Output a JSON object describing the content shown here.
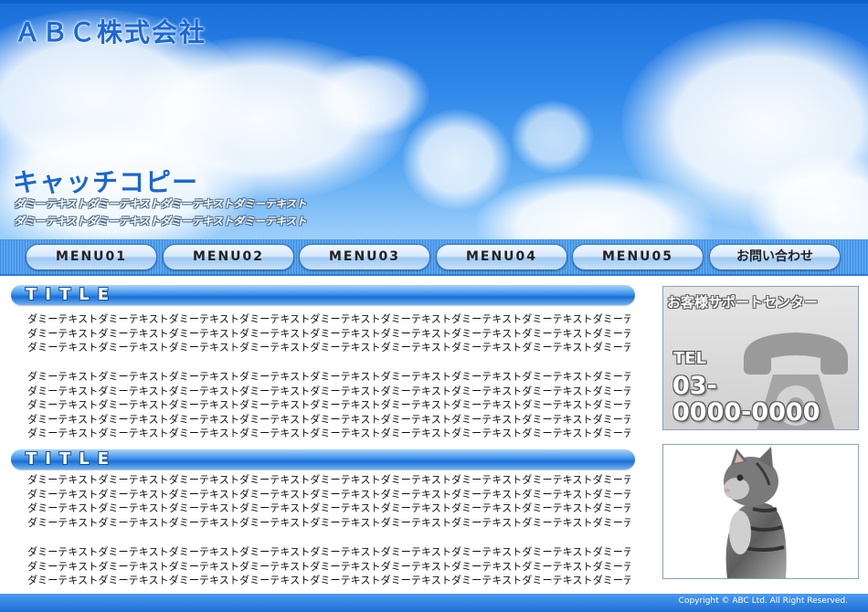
{
  "header": {
    "company_name": "ＡＢＣ株式会社",
    "catch_copy": "キャッチコピー",
    "catch_sub_lines": [
      "ダミーテキストダミーテキストダミーテキストダミーテキスト",
      "ダミーテキストダミーテキストダミーテキストダミーテキスト"
    ]
  },
  "nav": {
    "items": [
      {
        "label": "MENU01"
      },
      {
        "label": "MENU02"
      },
      {
        "label": "MENU03"
      },
      {
        "label": "MENU04"
      },
      {
        "label": "MENU05"
      },
      {
        "label": "お問い合わせ"
      }
    ]
  },
  "main": {
    "sections": [
      {
        "title": "TITLE",
        "paragraphs": [
          [
            "ダミーテキストダミーテキストダミーテキストダミーテキストダミーテキストダミーテキストダミーテキストダミーテキストダミーテキスト",
            "ダミーテキストダミーテキストダミーテキストダミーテキストダミーテキストダミーテキストダミーテキストダミーテキストダミーテキスト",
            "ダミーテキストダミーテキストダミーテキストダミーテキストダミーテキストダミーテキストダミーテキストダミーテキストダミーテキスト"
          ],
          [
            "ダミーテキストダミーテキストダミーテキストダミーテキストダミーテキストダミーテキストダミーテキストダミーテキストダミーテキスト",
            "ダミーテキストダミーテキストダミーテキストダミーテキストダミーテキストダミーテキストダミーテキストダミーテキストダミーテキスト",
            "ダミーテキストダミーテキストダミーテキストダミーテキストダミーテキストダミーテキストダミーテキストダミーテキストダミーテキスト",
            "ダミーテキストダミーテキストダミーテキストダミーテキストダミーテキストダミーテキストダミーテキストダミーテキストダミーテキスト",
            "ダミーテキストダミーテキストダミーテキストダミーテキストダミーテキストダミーテキストダミーテキストダミーテキストダミーテキスト"
          ]
        ]
      },
      {
        "title": "TITLE",
        "paragraphs": [
          [
            "ダミーテキストダミーテキストダミーテキストダミーテキストダミーテキストダミーテキストダミーテキストダミーテキストダミーテキスト",
            "ダミーテキストダミーテキストダミーテキストダミーテキストダミーテキストダミーテキストダミーテキストダミーテキストダミーテキスト",
            "ダミーテキストダミーテキストダミーテキストダミーテキストダミーテキストダミーテキストダミーテキストダミーテキストダミーテキスト",
            "ダミーテキストダミーテキストダミーテキストダミーテキストダミーテキストダミーテキストダミーテキストダミーテキストダミーテキスト"
          ],
          [
            "ダミーテキストダミーテキストダミーテキストダミーテキストダミーテキストダミーテキストダミーテキストダミーテキストダミーテキスト",
            "ダミーテキストダミーテキストダミーテキストダミーテキストダミーテキストダミーテキストダミーテキストダミーテキストダミーテキスト",
            "ダミーテキストダミーテキストダミーテキストダミーテキストダミーテキストダミーテキストダミーテキストダミーテキストダミーテキスト"
          ]
        ]
      }
    ]
  },
  "sidebar": {
    "support": {
      "heading": "お客様サポートセンター",
      "tel_label": "TEL",
      "number_line1": "03-",
      "number_line2": "0000-0000",
      "icon": "telephone-icon"
    },
    "image": {
      "icon": "kitten-photo"
    }
  },
  "footer": {
    "copyright": "Copyright © ABC Ltd. All Right Reserved."
  },
  "colors": {
    "brand_blue": "#1a67d8",
    "nav_blue": "#3b8fe6",
    "footer_blue": "#1e6fd4"
  }
}
